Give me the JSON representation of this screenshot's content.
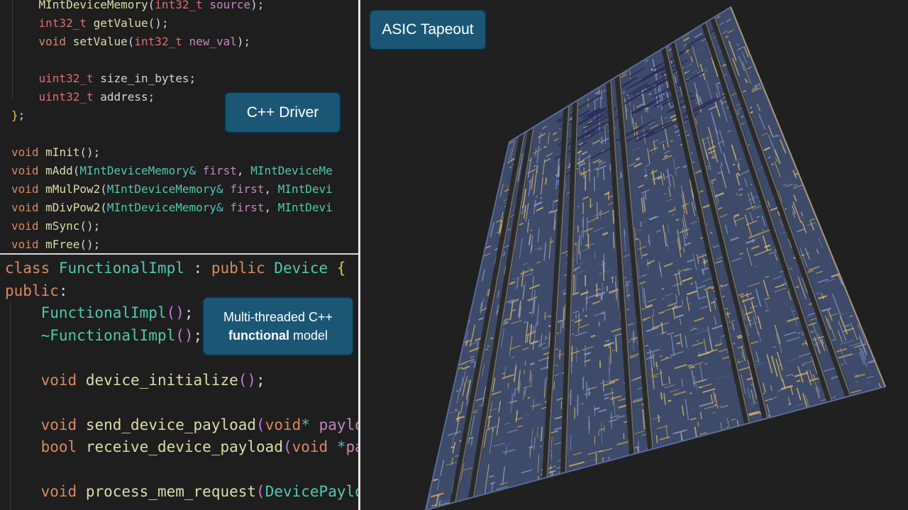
{
  "panels": {
    "driver": {
      "callout": "C++ Driver",
      "lines": [
        [
          [
            "fn",
            "    MIntDeviceMemory"
          ],
          [
            "p",
            "("
          ],
          [
            "type",
            "int32_t"
          ],
          [
            "p",
            " "
          ],
          [
            "param",
            "source"
          ],
          [
            "p",
            ");"
          ]
        ],
        [
          [
            "p",
            "    "
          ],
          [
            "type",
            "int32_t"
          ],
          [
            "p",
            " "
          ],
          [
            "fn",
            "getValue"
          ],
          [
            "p",
            "();"
          ]
        ],
        [
          [
            "p",
            "    "
          ],
          [
            "kw",
            "void"
          ],
          [
            "p",
            " "
          ],
          [
            "fn",
            "setValue"
          ],
          [
            "p",
            "("
          ],
          [
            "type",
            "int32_t"
          ],
          [
            "p",
            " "
          ],
          [
            "param",
            "new_val"
          ],
          [
            "p",
            ");"
          ]
        ],
        [],
        [
          [
            "p",
            "    "
          ],
          [
            "type",
            "uint32_t"
          ],
          [
            "p",
            " size_in_bytes;"
          ]
        ],
        [
          [
            "p",
            "    "
          ],
          [
            "type",
            "uint32_t"
          ],
          [
            "p",
            " address;"
          ]
        ],
        [
          [
            "br",
            "}"
          ],
          [
            "p",
            ";"
          ]
        ],
        [],
        [
          [
            "kw",
            "void"
          ],
          [
            "p",
            " "
          ],
          [
            "fn",
            "mInit"
          ],
          [
            "p",
            "();"
          ]
        ],
        [
          [
            "kw",
            "void"
          ],
          [
            "p",
            " "
          ],
          [
            "fn",
            "mAdd"
          ],
          [
            "p",
            "("
          ],
          [
            "cls",
            "MIntDeviceMemory"
          ],
          [
            "amp",
            "&"
          ],
          [
            "p",
            " "
          ],
          [
            "param",
            "first"
          ],
          [
            "p",
            ", "
          ],
          [
            "cls",
            "MIntDeviceMe"
          ]
        ],
        [
          [
            "kw",
            "void"
          ],
          [
            "p",
            " "
          ],
          [
            "fn",
            "mMulPow2"
          ],
          [
            "p",
            "("
          ],
          [
            "cls",
            "MIntDeviceMemory"
          ],
          [
            "amp",
            "&"
          ],
          [
            "p",
            " "
          ],
          [
            "param",
            "first"
          ],
          [
            "p",
            ", "
          ],
          [
            "cls",
            "MIntDevi"
          ]
        ],
        [
          [
            "kw",
            "void"
          ],
          [
            "p",
            " "
          ],
          [
            "fn",
            "mDivPow2"
          ],
          [
            "p",
            "("
          ],
          [
            "cls",
            "MIntDeviceMemory"
          ],
          [
            "amp",
            "&"
          ],
          [
            "p",
            " "
          ],
          [
            "param",
            "first"
          ],
          [
            "p",
            ", "
          ],
          [
            "cls",
            "MIntDevi"
          ]
        ],
        [
          [
            "kw",
            "void"
          ],
          [
            "p",
            " "
          ],
          [
            "fn",
            "mSync"
          ],
          [
            "p",
            "();"
          ]
        ],
        [
          [
            "kw",
            "void"
          ],
          [
            "p",
            " "
          ],
          [
            "fn",
            "mFree"
          ],
          [
            "p",
            "();"
          ]
        ]
      ]
    },
    "model": {
      "callout_line1": "Multi-threaded C++",
      "callout_bold": "functional",
      "callout_rest": " model",
      "lines": [
        [
          [
            "kw",
            "class"
          ],
          [
            "p",
            " "
          ],
          [
            "cls",
            "FunctionalImpl"
          ],
          [
            "p",
            " : "
          ],
          [
            "kw",
            "public"
          ],
          [
            "p",
            " "
          ],
          [
            "cls",
            "Device"
          ],
          [
            "p",
            " "
          ],
          [
            "br",
            "{"
          ]
        ],
        [
          [
            "kw",
            "public"
          ],
          [
            "p",
            ":"
          ]
        ],
        [
          [
            "p",
            "    "
          ],
          [
            "cls",
            "FunctionalImpl"
          ],
          [
            "brp",
            "()"
          ],
          [
            "p",
            ";"
          ]
        ],
        [
          [
            "p",
            "    "
          ],
          [
            "cls",
            "~FunctionalImpl"
          ],
          [
            "brp",
            "()"
          ],
          [
            "p",
            ";"
          ]
        ],
        [],
        [
          [
            "p",
            "    "
          ],
          [
            "kw",
            "void"
          ],
          [
            "p",
            " "
          ],
          [
            "fn",
            "device_initialize"
          ],
          [
            "brp",
            "()"
          ],
          [
            "p",
            ";"
          ]
        ],
        [],
        [
          [
            "p",
            "    "
          ],
          [
            "kw",
            "void"
          ],
          [
            "p",
            " "
          ],
          [
            "fn",
            "send_device_payload"
          ],
          [
            "brp",
            "("
          ],
          [
            "kw",
            "void"
          ],
          [
            "star",
            "*"
          ],
          [
            "p",
            " "
          ],
          [
            "param",
            "paylo"
          ]
        ],
        [
          [
            "p",
            "    "
          ],
          [
            "kw",
            "bool"
          ],
          [
            "p",
            " "
          ],
          [
            "fn",
            "receive_device_payload"
          ],
          [
            "brp",
            "("
          ],
          [
            "kw",
            "void"
          ],
          [
            "p",
            " "
          ],
          [
            "star",
            "*"
          ],
          [
            "param",
            "pa"
          ]
        ],
        [],
        [
          [
            "p",
            "    "
          ],
          [
            "kw",
            "void"
          ],
          [
            "p",
            " "
          ],
          [
            "fn",
            "process_mem_request"
          ],
          [
            "brp",
            "("
          ],
          [
            "cls",
            "DevicePaylo"
          ]
        ]
      ]
    },
    "chip": {
      "callout": "ASIC Tapeout"
    }
  }
}
